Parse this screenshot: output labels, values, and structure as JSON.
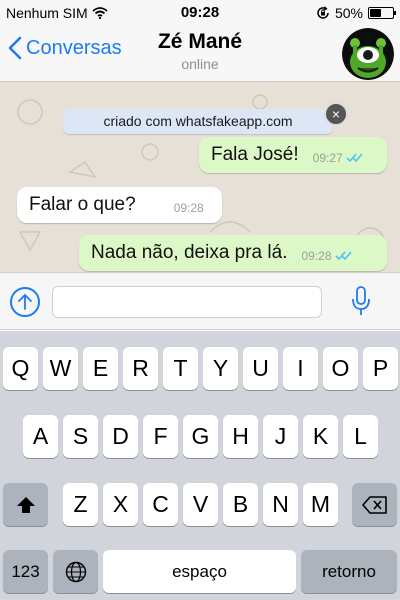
{
  "status_bar": {
    "carrier": "Nenhum SIM",
    "time": "09:28",
    "battery_percent": "50%",
    "battery_level": 0.5
  },
  "nav": {
    "back_label": "Conversas",
    "contact_name": "Zé Mané",
    "presence": "online"
  },
  "chat": {
    "banner": "criado com whatsfakeapp.com",
    "banner_close": "×",
    "messages": [
      {
        "direction": "out",
        "text": "Fala José!",
        "time": "09:27",
        "status": "read"
      },
      {
        "direction": "in",
        "text": "Falar o que?",
        "time": "09:28"
      },
      {
        "direction": "out",
        "text": "Nada não, deixa pra lá.",
        "time": "09:28",
        "status": "read"
      }
    ]
  },
  "input": {
    "value": "",
    "placeholder": ""
  },
  "keyboard": {
    "row1": [
      "Q",
      "W",
      "E",
      "R",
      "T",
      "Y",
      "U",
      "I",
      "O",
      "P"
    ],
    "row2": [
      "A",
      "S",
      "D",
      "F",
      "G",
      "H",
      "J",
      "K",
      "L"
    ],
    "row3": [
      "Z",
      "X",
      "C",
      "V",
      "B",
      "N",
      "M"
    ],
    "numbers_label": "123",
    "space_label": "espaço",
    "return_label": "retorno"
  },
  "colors": {
    "accent": "#1d7cf2",
    "bubble_out": "#dcf8c6",
    "read_ticks": "#4fc3f7"
  }
}
